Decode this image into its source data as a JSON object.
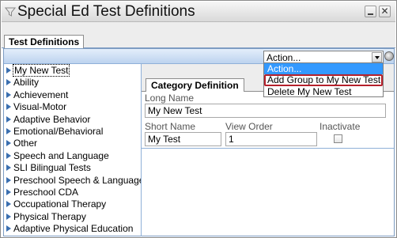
{
  "window": {
    "title": "Special Ed Test Definitions"
  },
  "tabs": {
    "main": "Test Definitions"
  },
  "action": {
    "selected": "Action...",
    "options": [
      "Action...",
      "Add Group to My New Test",
      "Delete My New Test"
    ]
  },
  "tree": {
    "items": [
      "My New Test",
      "Ability",
      "Achievement",
      "Visual-Motor",
      "Adaptive Behavior",
      "Emotional/Behavioral",
      "Other",
      "Speech and Language",
      "SLI Bilingual Tests",
      "Preschool Speech & Language",
      "Preschool CDA",
      "Occupational Therapy",
      "Physical Therapy",
      "Adaptive Physical Education"
    ]
  },
  "detail": {
    "tab": "Category Definition",
    "long_name_label": "Long Name",
    "long_name_value": "My New Test",
    "short_name_label": "Short Name",
    "short_name_value": "My Test",
    "view_order_label": "View Order",
    "view_order_value": "1",
    "inactivate_label": "Inactivate"
  },
  "colors": {
    "highlight": "#3399ff",
    "callout": "#b5202b",
    "tree_triangle": "#3a6fb0"
  }
}
